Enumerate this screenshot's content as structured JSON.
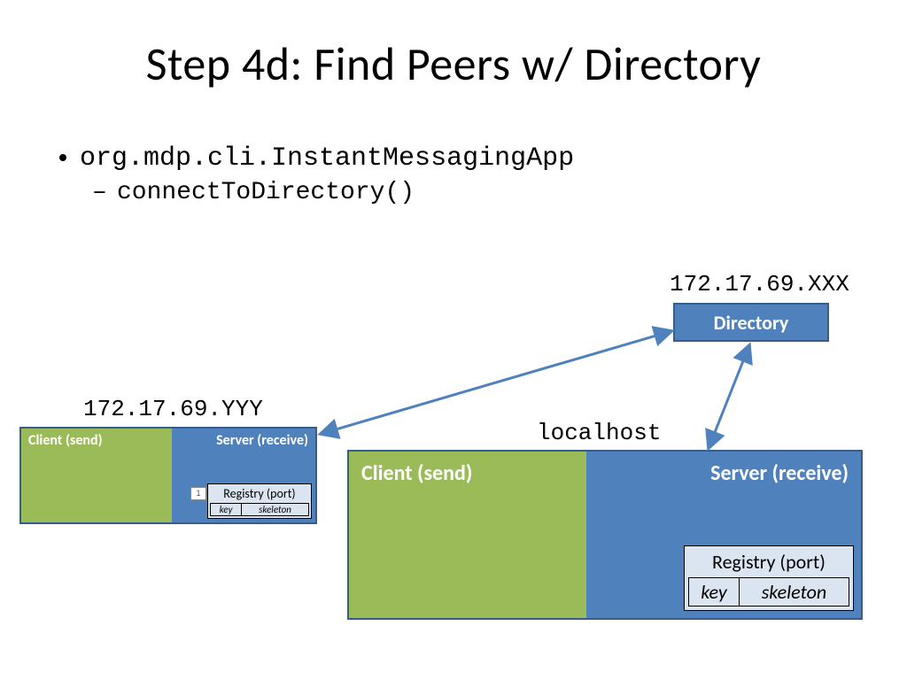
{
  "title": "Step 4d: Find Peers w/ Directory",
  "bullets": {
    "class": "org.mdp.cli.InstantMessagingApp",
    "method": "connectToDirectory()"
  },
  "directory": {
    "label": "Directory",
    "ip": "172.17.69.XXX"
  },
  "peer": {
    "ip": "172.17.69.YYY",
    "client_label": "Client (send)",
    "server_label": "Server (receive)",
    "registry_label": "Registry (port)",
    "key_label": "key",
    "skeleton_label": "skeleton",
    "count": "1"
  },
  "local": {
    "ip": "localhost",
    "client_label": "Client (send)",
    "server_label": "Server (receive)",
    "registry_label": "Registry (port)",
    "key_label": "key",
    "skeleton_label": "skeleton"
  },
  "colors": {
    "blue": "#4f81bd",
    "blue_border": "#385d8a",
    "green": "#9bbb59",
    "pale_blue": "#dbe5f1"
  }
}
